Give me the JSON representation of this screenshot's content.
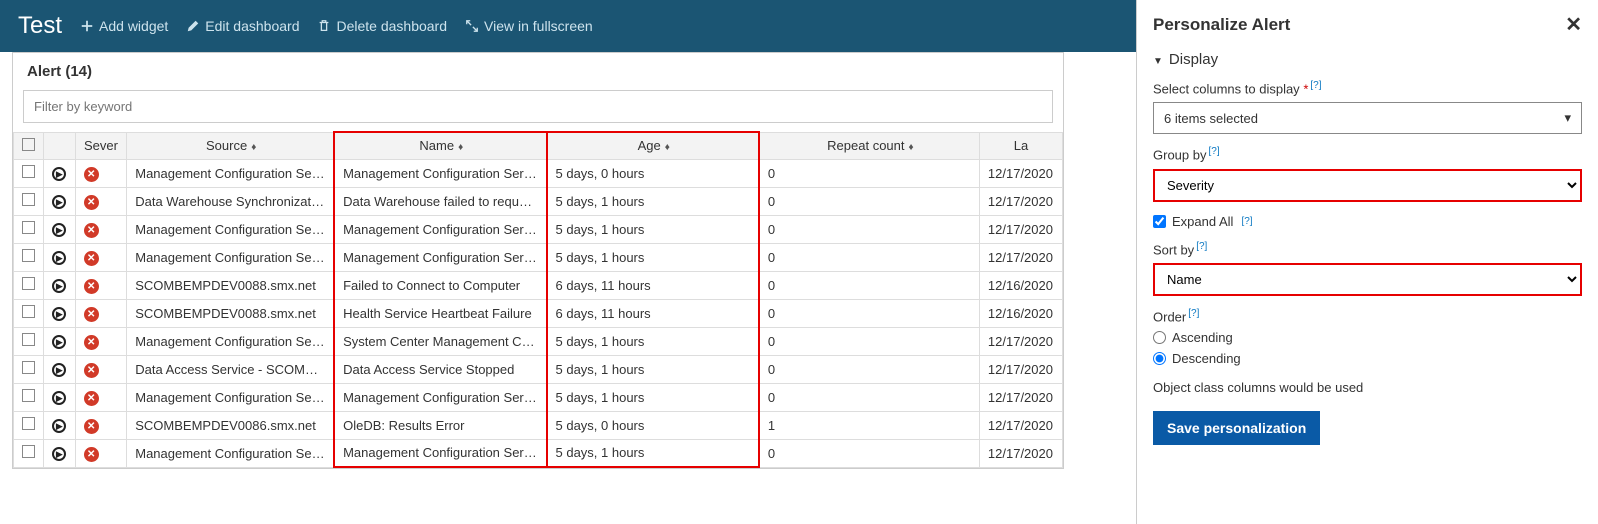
{
  "header": {
    "title": "Test",
    "add_widget": "Add widget",
    "edit_dashboard": "Edit dashboard",
    "delete_dashboard": "Delete dashboard",
    "fullscreen": "View in fullscreen"
  },
  "alert": {
    "title": "Alert (14)",
    "filter_placeholder": "Filter by keyword",
    "columns": {
      "severity": "Sever",
      "source": "Source",
      "name": "Name",
      "age": "Age",
      "repeat": "Repeat count",
      "last": "La"
    },
    "rows": [
      {
        "source": "Management Configuration Service",
        "name": "Management Configuration Service",
        "age": "5 days, 0 hours",
        "repeat": "0",
        "last": "12/17/2020"
      },
      {
        "source": "Data Warehouse Synchronization Se",
        "name": "Data Warehouse failed to request a l",
        "age": "5 days, 1 hours",
        "repeat": "0",
        "last": "12/17/2020"
      },
      {
        "source": "Management Configuration Service",
        "name": "Management Configuration Service",
        "age": "5 days, 1 hours",
        "repeat": "0",
        "last": "12/17/2020"
      },
      {
        "source": "Management Configuration Service",
        "name": "Management Configuration Service",
        "age": "5 days, 1 hours",
        "repeat": "0",
        "last": "12/17/2020"
      },
      {
        "source": "SCOMBEMPDEV0088.smx.net",
        "name": "Failed to Connect to Computer",
        "age": "6 days, 11 hours",
        "repeat": "0",
        "last": "12/16/2020"
      },
      {
        "source": "SCOMBEMPDEV0088.smx.net",
        "name": "Health Service Heartbeat Failure",
        "age": "6 days, 11 hours",
        "repeat": "0",
        "last": "12/16/2020"
      },
      {
        "source": "Management Configuration Service",
        "name": "System Center Management Configu",
        "age": "5 days, 1 hours",
        "repeat": "0",
        "last": "12/17/2020"
      },
      {
        "source": "Data Access Service - SCOMBEMPDE",
        "name": "Data Access Service Stopped",
        "age": "5 days, 1 hours",
        "repeat": "0",
        "last": "12/17/2020"
      },
      {
        "source": "Management Configuration Service",
        "name": "Management Configuration Service",
        "age": "5 days, 1 hours",
        "repeat": "0",
        "last": "12/17/2020"
      },
      {
        "source": "SCOMBEMPDEV0086.smx.net",
        "name": "OleDB: Results Error",
        "age": "5 days, 0 hours",
        "repeat": "1",
        "last": "12/17/2020"
      },
      {
        "source": "Management Configuration Service",
        "name": "Management Configuration Service",
        "age": "5 days, 1 hours",
        "repeat": "0",
        "last": "12/17/2020"
      }
    ]
  },
  "panel": {
    "title": "Personalize Alert",
    "display": "Display",
    "select_cols": "Select columns to display",
    "cols_value": "6 items selected",
    "group_by": "Group by",
    "group_by_value": "Severity",
    "expand_all": "Expand All",
    "sort_by": "Sort by",
    "sort_by_value": "Name",
    "order": "Order",
    "asc": "Ascending",
    "desc": "Descending",
    "note": "Object class columns would be used",
    "save": "Save personalization"
  }
}
